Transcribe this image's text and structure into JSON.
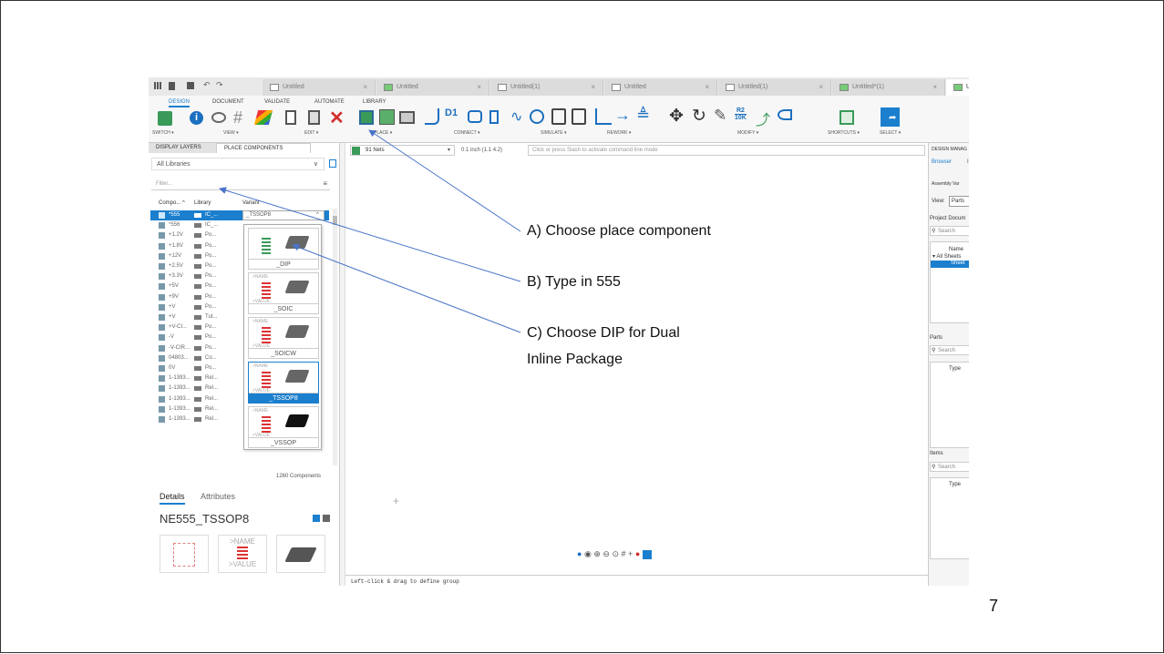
{
  "file_tabs": [
    "Untitled",
    "Untitled",
    "Untitled(1)",
    "Untitled",
    "Untitled(1)",
    "Untitled*(1)",
    "Un"
  ],
  "ribbon": {
    "tabs": [
      "DESIGN",
      "DOCUMENT",
      "VALIDATE",
      "AUTOMATE",
      "LIBRARY"
    ],
    "groups": [
      "SWITCH ▾",
      "VIEW ▾",
      "EDIT ▾",
      "PLACE ▾",
      "CONNECT ▾",
      "SIMULATE ▾",
      "REWORK ▾",
      "MODIFY ▾",
      "SHORTCUTS ▾",
      "SELECT ▾"
    ],
    "icon_labels": {
      "d1": "D1",
      "r2": "R2",
      "r2_val": "10K"
    }
  },
  "left_panel": {
    "tabs": [
      "DISPLAY LAYERS",
      "PLACE COMPONENTS"
    ],
    "library_select": "All Libraries",
    "filter_placeholder": "Filter...",
    "columns": [
      "Compo...",
      "Library",
      "Variant"
    ],
    "sort_arrow": "^",
    "rows": [
      {
        "name": "*555",
        "lib": "IC_...",
        "variant": "_TSSOP8"
      },
      {
        "name": "*556",
        "lib": "IC_..."
      },
      {
        "name": "+1.2V",
        "lib": "Po..."
      },
      {
        "name": "+1.8V",
        "lib": "Po..."
      },
      {
        "name": "+12V",
        "lib": "Po..."
      },
      {
        "name": "+2.5V",
        "lib": "Po..."
      },
      {
        "name": "+3.3V",
        "lib": "Po..."
      },
      {
        "name": "+5V",
        "lib": "Po..."
      },
      {
        "name": "+9V",
        "lib": "Po..."
      },
      {
        "name": "+V",
        "lib": "Po..."
      },
      {
        "name": "+V",
        "lib": "Tut..."
      },
      {
        "name": "+V-CI...",
        "lib": "Po..."
      },
      {
        "name": "-V",
        "lib": "Po..."
      },
      {
        "name": "-V-CIR...",
        "lib": "Po..."
      },
      {
        "name": "04803...",
        "lib": "Co..."
      },
      {
        "name": "0V",
        "lib": "Po..."
      },
      {
        "name": "1-1393...",
        "lib": "Rel..."
      },
      {
        "name": "1-1393...",
        "lib": "Rel..."
      },
      {
        "name": "1-1393...",
        "lib": "Rel..."
      },
      {
        "name": "1-1393...",
        "lib": "Rel..."
      },
      {
        "name": "1-1393...",
        "lib": "Rel..."
      }
    ],
    "variant_options": [
      "_DIP",
      "_SOIC",
      "_SOICW",
      "_TSSOP8",
      "_VSSOP"
    ],
    "card_text": {
      "name": ">NAME",
      "value": ">VALUE"
    },
    "component_count": "1260 Components",
    "details_tabs": [
      "Details",
      "Attributes"
    ],
    "details_title": "NE555_TSSOP8",
    "preview_name": ">NAME",
    "preview_value": ">VALUE"
  },
  "canvas": {
    "nets_select": "91 Nets",
    "coordinates": "0.1 inch (1.1 4.2)",
    "command_placeholder": "Click or press Slash to activate command line mode",
    "status_line": "Left-click & drag to define group"
  },
  "right_panel": {
    "header": "DESIGN MANAG",
    "tabs": [
      "Browser",
      "I"
    ],
    "assembly_label": "Assembly Var",
    "view_label": "View:",
    "view_value": "Parts",
    "project_label": "Project Docum",
    "search_placeholder": "Search",
    "name_col": "Name",
    "tree": [
      "All Sheets",
      "Sheet"
    ],
    "parts_label": "Parts",
    "items_label": "Items",
    "type_col": "Type"
  },
  "annotations": {
    "a": "A) Choose  place component",
    "b": "B) Type in 555",
    "c1": "C) Choose DIP for Dual",
    "c2": "Inline Package"
  },
  "page_number": "7",
  "colors": {
    "accent": "#1b7fce",
    "arrow": "#4a74c9",
    "red": "#d32f2f"
  }
}
